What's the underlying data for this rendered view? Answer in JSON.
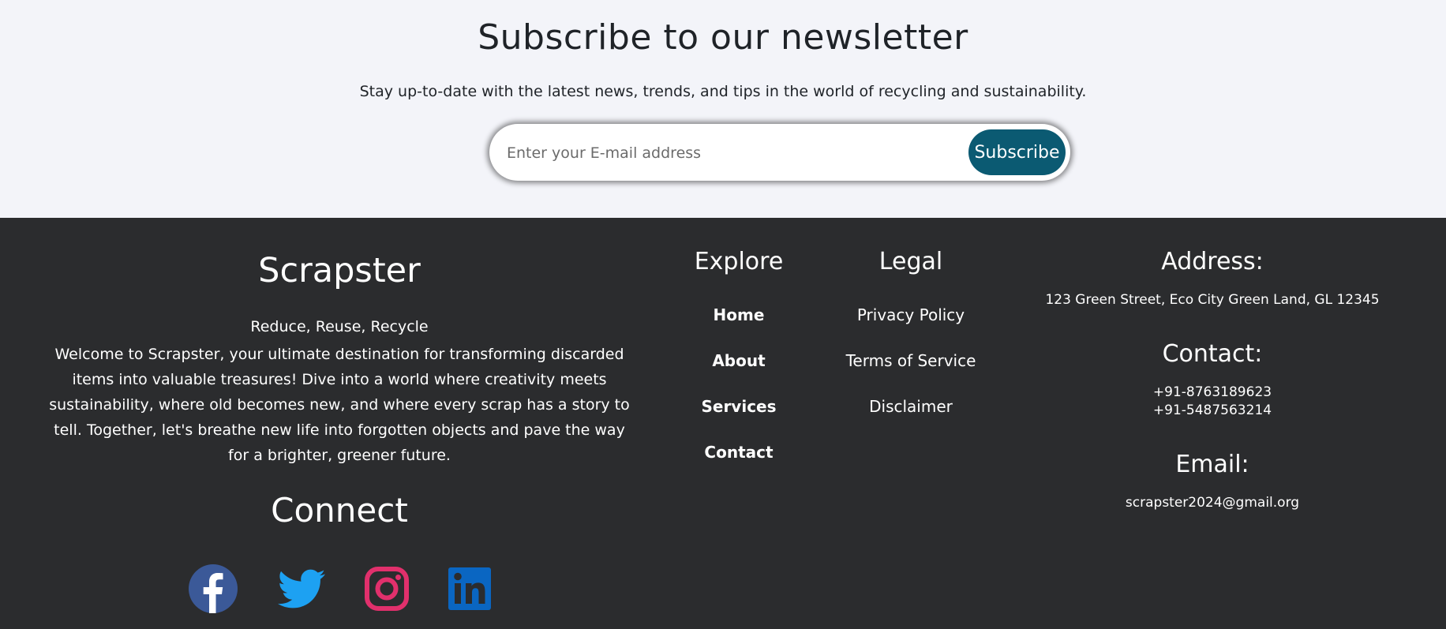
{
  "newsletter": {
    "title": "Subscribe to our newsletter",
    "subtitle": "Stay up-to-date with the latest news, trends, and tips in the world of recycling and sustainability.",
    "email_placeholder": "Enter your E-mail address",
    "email_value": "",
    "subscribe_label": "Subscribe",
    "accent_color": "#0b5a72"
  },
  "footer": {
    "brand": {
      "name": "Scrapster",
      "tagline": "Reduce, Reuse, Recycle",
      "description": "Welcome to Scrapster, your ultimate destination for transforming discarded items into valuable treasures! Dive into a world where creativity meets sustainability, where old becomes new, and where every scrap has a story to tell. Together, let's breathe new life into forgotten objects and pave the way for a brighter, greener future."
    },
    "connect": {
      "title": "Connect",
      "icons": [
        {
          "name": "facebook-icon",
          "color": "#3b5998"
        },
        {
          "name": "twitter-icon",
          "color": "#1da1f2"
        },
        {
          "name": "instagram-icon",
          "color": "#e1306c"
        },
        {
          "name": "linkedin-icon",
          "color": "#0a66c2"
        }
      ]
    },
    "explore": {
      "title": "Explore",
      "links": [
        "Home",
        "About",
        "Services",
        "Contact"
      ]
    },
    "legal": {
      "title": "Legal",
      "links": [
        "Privacy Policy",
        "Terms of Service",
        "Disclaimer"
      ]
    },
    "address": {
      "title": "Address:",
      "value": "123 Green Street, Eco City Green Land, GL 12345"
    },
    "contact": {
      "title": "Contact:",
      "phones": [
        "+91-8763189623",
        "+91-5487563214"
      ]
    },
    "email": {
      "title": "Email:",
      "value": "scrapster2024@gmail.org"
    },
    "background_color": "#2b2c2e"
  }
}
